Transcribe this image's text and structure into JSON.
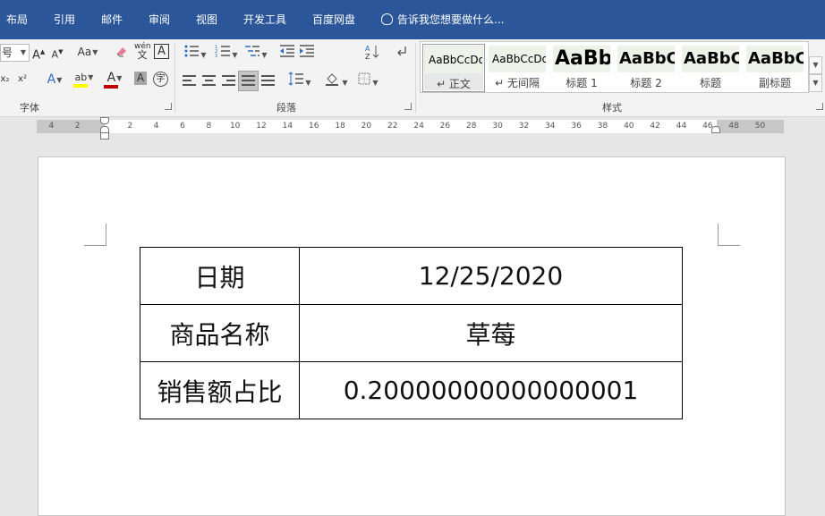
{
  "tabs": [
    "布局",
    "引用",
    "邮件",
    "审阅",
    "视图",
    "开发工具",
    "百度网盘"
  ],
  "tell_me": "告诉我您想要做什么...",
  "font_group": {
    "label": "字体",
    "size_fragment": "号",
    "grow_font": "A",
    "shrink_font": "A",
    "change_case": "Aa",
    "phonetic_top": "wén",
    "phonetic_bottom": "文",
    "char_border": "A",
    "subscript": "x₂",
    "superscript": "x²",
    "text_effect": "A",
    "highlight": "ab",
    "font_color": "A",
    "char_shading": "A",
    "enclose": "字",
    "highlight_color": "#ffff00",
    "font_color_value": "#c00000"
  },
  "paragraph_group": {
    "label": "段落"
  },
  "styles_group": {
    "label": "样式",
    "items": [
      {
        "preview": "AaBbCcDd",
        "name": "↵ 正文",
        "selected": true
      },
      {
        "preview": "AaBbCcDd",
        "name": "↵ 无间隔",
        "selected": false
      },
      {
        "preview": "AaBb",
        "name": "标题 1",
        "selected": false
      },
      {
        "preview": "AaBbC",
        "name": "标题 2",
        "selected": false
      },
      {
        "preview": "AaBbC",
        "name": "标题",
        "selected": false
      },
      {
        "preview": "AaBbC",
        "name": "副标题",
        "selected": false
      }
    ]
  },
  "ruler": {
    "left_labels": [
      "4",
      "2"
    ],
    "labels": [
      "2",
      "4",
      "6",
      "8",
      "10",
      "12",
      "14",
      "16",
      "18",
      "20",
      "22",
      "24",
      "26",
      "28",
      "30",
      "32",
      "34",
      "36",
      "38",
      "40",
      "42",
      "44",
      "46",
      "48",
      "50"
    ]
  },
  "table": [
    {
      "label": "日期",
      "value": "12/25/2020"
    },
    {
      "label": "商品名称",
      "value": "草莓"
    },
    {
      "label": "销售额占比",
      "value": "0.20000000000000001"
    }
  ],
  "colors": {
    "ribbon_tab_bar": "#2b579a",
    "style_preview_bg": "#eef3ea"
  }
}
